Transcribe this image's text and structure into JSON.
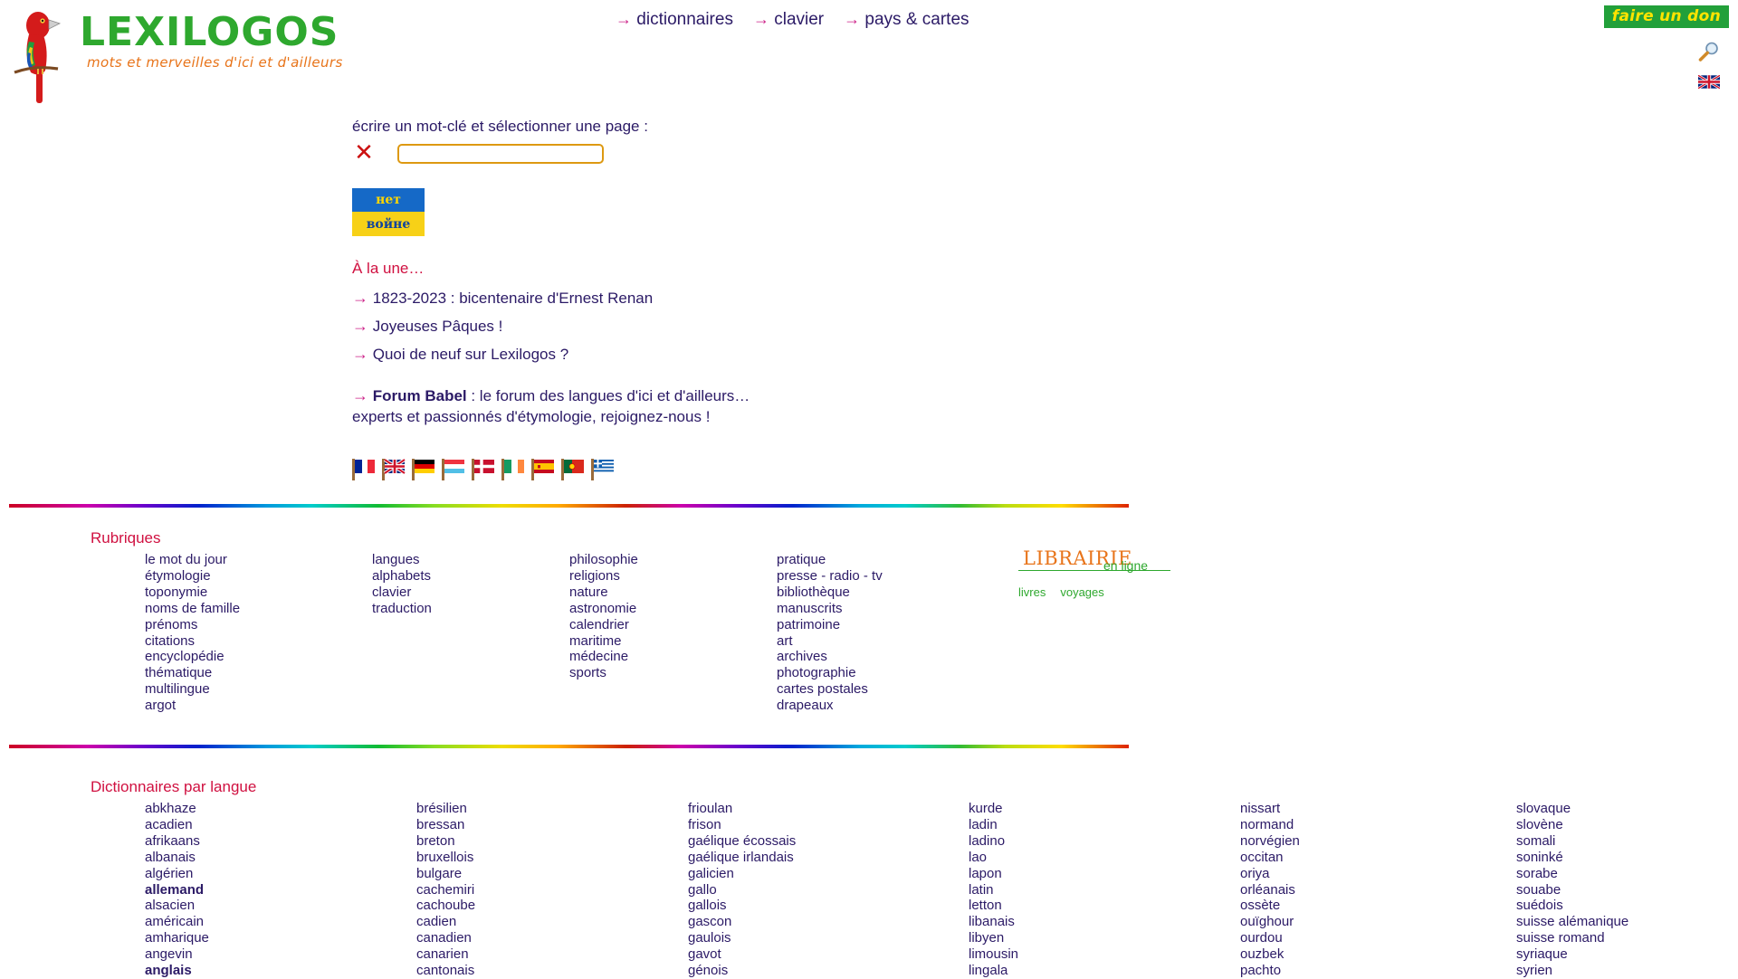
{
  "header": {
    "logo_word": "LEXILOGOS",
    "logo_tagline": "mots et merveilles d'ici et d'ailleurs",
    "nav": [
      {
        "arrow": "→",
        "label": "dictionnaires"
      },
      {
        "arrow": "→",
        "label": "clavier"
      },
      {
        "arrow": "→",
        "label": "pays & cartes"
      }
    ],
    "donate_label": "faire un don",
    "search_icon": "magnifier-icon",
    "language_flag": "uk-flag"
  },
  "intro": {
    "label": "écrire un mot-clé et sélectionner une page :",
    "clear_icon": "✕",
    "input_value": "",
    "input_placeholder": ""
  },
  "ukraine_banner": {
    "top_text": "нет",
    "bottom_text": "войне",
    "blue": "#1569c7",
    "yellow": "#f7d117"
  },
  "news": {
    "title": "À la une…",
    "items": [
      "1823-2023 : bicentenaire d'Ernest Renan",
      "Joyeuses Pâques !",
      "Quoi de neuf sur Lexilogos ?"
    ]
  },
  "forum": {
    "arrow": "→",
    "name": "Forum Babel",
    "rest": " : le forum des langues d'ici et d'ailleurs…",
    "line2": "experts et passionnés d'étymologie, rejoignez-nous !"
  },
  "flags": [
    "france-flag",
    "united-kingdom-flag",
    "germany-flag",
    "luxembourg-flag",
    "denmark-flag",
    "ireland-flag",
    "spain-flag",
    "portugal-flag",
    "greece-flag"
  ],
  "rubriques": {
    "title": "Rubriques",
    "columns": [
      [
        "le mot du jour",
        "étymologie",
        "toponymie",
        "noms de famille",
        "prénoms",
        "citations",
        "encyclopédie",
        "thématique",
        "multilingue",
        "argot"
      ],
      [
        "langues",
        "alphabets",
        "clavier",
        "traduction"
      ],
      [
        "philosophie",
        "religions",
        "nature",
        "astronomie",
        "calendrier",
        "maritime",
        "médecine",
        "sports"
      ],
      [
        "pratique",
        "presse - radio - tv",
        "bibliothèque",
        "manuscrits",
        "patrimoine",
        "art",
        "archives",
        "photographie",
        "cartes postales",
        "drapeaux"
      ]
    ]
  },
  "librairie": {
    "word": "LIBRAIRIE",
    "subtitle": "en ligne",
    "links": [
      "livres",
      "voyages"
    ],
    "orange": "#e8741a",
    "green": "#2ea82e"
  },
  "dictionnaires": {
    "title": "Dictionnaires par langue",
    "bold_entries": [
      "allemand",
      "anglais"
    ],
    "columns": [
      [
        "abkhaze",
        "acadien",
        "afrikaans",
        "albanais",
        "algérien",
        "allemand",
        "alsacien",
        "américain",
        "amharique",
        "angevin",
        "anglais"
      ],
      [
        "brésilien",
        "bressan",
        "breton",
        "bruxellois",
        "bulgare",
        "cachemiri",
        "cachoube",
        "cadien",
        "canadien",
        "canarien",
        "cantonais"
      ],
      [
        "frioulan",
        "frison",
        "gaélique écossais",
        "gaélique irlandais",
        "galicien",
        "gallo",
        "gallois",
        "gascon",
        "gaulois",
        "gavot",
        "génois"
      ],
      [
        "kurde",
        "ladin",
        "ladino",
        "lao",
        "lapon",
        "latin",
        "letton",
        "libanais",
        "libyen",
        "limousin",
        "lingala"
      ],
      [
        "nissart",
        "normand",
        "norvégien",
        "occitan",
        "oriya",
        "orléanais",
        "ossète",
        "ouïghour",
        "ourdou",
        "ouzbek",
        "pachto"
      ],
      [
        "slovaque",
        "slovène",
        "somali",
        "soninké",
        "sorabe",
        "souabe",
        "suédois",
        "suisse alémanique",
        "suisse romand",
        "syriaque",
        "syrien"
      ]
    ]
  },
  "colors": {
    "link": "#2b1a66",
    "arrow": "#cc2288",
    "heading": "#d01040",
    "logo_green": "#2ea82e",
    "logo_orange": "#e8741a",
    "donate_bg": "#22a03a",
    "donate_text": "#ffe400",
    "input_border": "#dd9911"
  }
}
